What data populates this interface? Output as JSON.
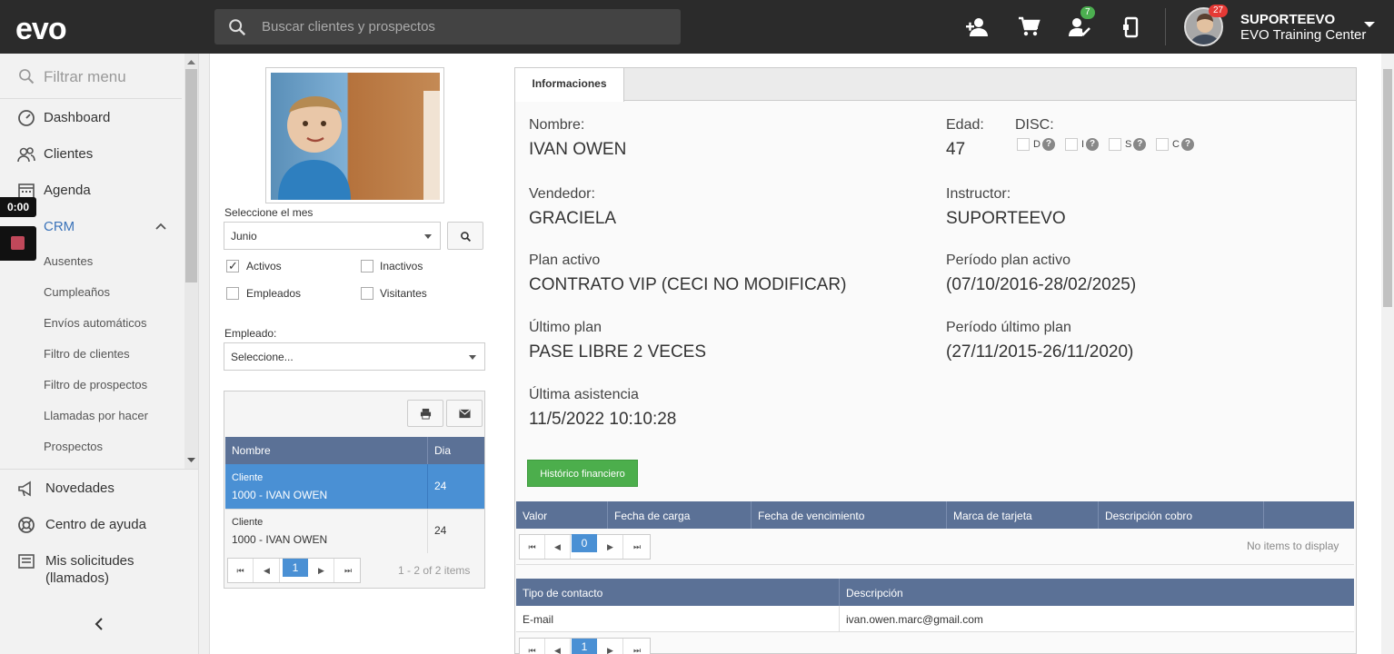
{
  "header": {
    "logo": "evo",
    "search_placeholder": "Buscar clientes y prospectos",
    "badge_tasks": "7",
    "badge_avatar": "27",
    "user_name": "SUPORTEEVO",
    "user_company": "EVO Training Center"
  },
  "sidebar": {
    "filter_placeholder": "Filtrar menu",
    "items": [
      {
        "label": "Dashboard"
      },
      {
        "label": "Clientes"
      },
      {
        "label": "Agenda"
      },
      {
        "label": "CRM"
      }
    ],
    "crm_sub": [
      {
        "label": "Ausentes"
      },
      {
        "label": "Cumpleaños"
      },
      {
        "label": "Envíos automáticos"
      },
      {
        "label": "Filtro de clientes"
      },
      {
        "label": "Filtro de prospectos"
      },
      {
        "label": "Llamadas por hacer"
      },
      {
        "label": "Prospectos"
      }
    ],
    "bottom": [
      {
        "label": "Novedades"
      },
      {
        "label": "Centro de ayuda"
      },
      {
        "label": "Mis solicitudes",
        "label2": "(llamados)"
      }
    ],
    "timer": "0:00"
  },
  "filters": {
    "month_label": "Seleccione el mes",
    "month_value": "Junio",
    "activos": "Activos",
    "inactivos": "Inactivos",
    "empleados": "Empleados",
    "visitantes": "Visitantes",
    "empleado_label": "Empleado:",
    "empleado_value": "Seleccione..."
  },
  "client_grid": {
    "col_name": "Nombre",
    "col_day": "Dia",
    "rows": [
      {
        "type": "Cliente",
        "name": "1000 - IVAN OWEN",
        "day": "24"
      },
      {
        "type": "Cliente",
        "name": "1000 - IVAN OWEN",
        "day": "24"
      }
    ],
    "page": "1",
    "summary": "1 - 2 of 2 items"
  },
  "info": {
    "tab": "Informaciones",
    "nombre_label": "Nombre:",
    "nombre": "IVAN OWEN",
    "edad_label": "Edad:",
    "edad": "47",
    "disc_label": "DISC:",
    "disc": [
      "D",
      "I",
      "S",
      "C"
    ],
    "vendedor_label": "Vendedor:",
    "vendedor": "GRACIELA",
    "instructor_label": "Instructor:",
    "instructor": "SUPORTEEVO",
    "plan_label": "Plan activo",
    "plan": "CONTRATO VIP (CECI NO MODIFICAR)",
    "periodo_label": "Período plan activo",
    "periodo": "(07/10/2016-28/02/2025)",
    "ultimo_plan_label": "Último plan",
    "ultimo_plan": "PASE LIBRE 2 VECES",
    "periodo_ultimo_label": "Período último plan",
    "periodo_ultimo": "(27/11/2015-26/11/2020)",
    "asistencia_label": "Última asistencia",
    "asistencia": "11/5/2022 10:10:28",
    "btn_historico": "Histórico financiero"
  },
  "finance_table": {
    "cols": [
      "Valor",
      "Fecha de carga",
      "Fecha de vencimiento",
      "Marca de tarjeta",
      "Descripción cobro"
    ],
    "page": "0",
    "empty": "No items to display"
  },
  "contact_table": {
    "cols": [
      "Tipo de contacto",
      "Descripción"
    ],
    "row": {
      "tipo": "E-mail",
      "desc": "ivan.owen.marc@gmail.com"
    },
    "page": "1"
  }
}
